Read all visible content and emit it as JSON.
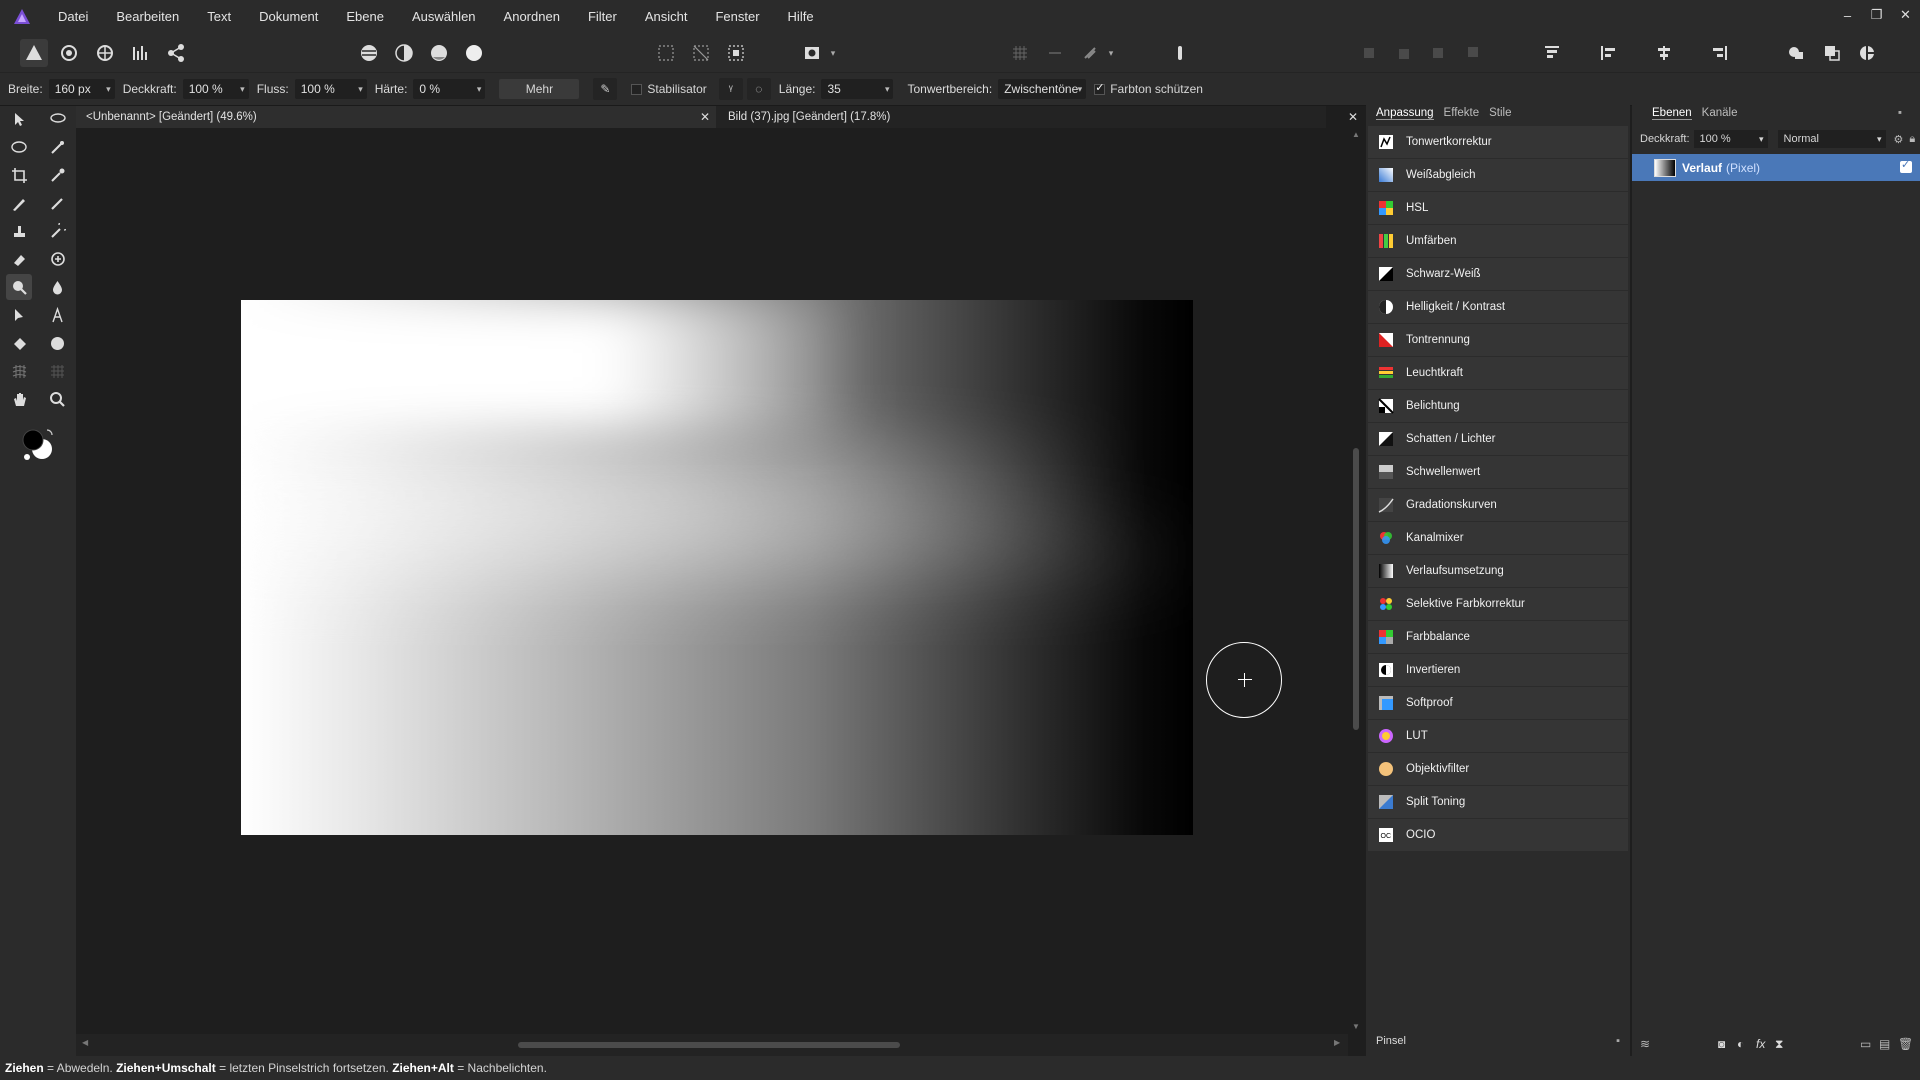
{
  "menubar": {
    "items": [
      "Datei",
      "Bearbeiten",
      "Text",
      "Dokument",
      "Ebene",
      "Auswählen",
      "Anordnen",
      "Filter",
      "Ansicht",
      "Fenster",
      "Hilfe"
    ],
    "window_buttons": {
      "minimize": "–",
      "restore": "❐",
      "close": "✕"
    }
  },
  "context": {
    "width_label": "Breite:",
    "width_value": "160 px",
    "opacity_label": "Deckkraft:",
    "opacity_value": "100 %",
    "flow_label": "Fluss:",
    "flow_value": "100 %",
    "hardness_label": "Härte:",
    "hardness_value": "0 %",
    "more_label": "Mehr",
    "stabilizer_label": "Stabilisator",
    "length_label": "Länge:",
    "length_value": "35",
    "tonal_label": "Tonwertbereich:",
    "tonal_value": "Zwischentöne",
    "protect_label": "Farbton schützen"
  },
  "doctabs": [
    {
      "title": "<Unbenannt> [Geändert] (49.6%)"
    },
    {
      "title": "Bild (37).jpg [Geändert] (17.8%)"
    }
  ],
  "adjust": {
    "tabs": [
      "Anpassung",
      "Effekte",
      "Stile"
    ],
    "items": [
      {
        "label": "Tonwertkorrektur",
        "icon": "levels-icon"
      },
      {
        "label": "Weißabgleich",
        "icon": "white-balance-icon"
      },
      {
        "label": "HSL",
        "icon": "hsl-icon"
      },
      {
        "label": "Umfärben",
        "icon": "recolor-icon"
      },
      {
        "label": "Schwarz-Weiß",
        "icon": "black-white-icon"
      },
      {
        "label": "Helligkeit / Kontrast",
        "icon": "brightness-contrast-icon"
      },
      {
        "label": "Tontrennung",
        "icon": "posterize-icon"
      },
      {
        "label": "Leuchtkraft",
        "icon": "vibrance-icon"
      },
      {
        "label": "Belichtung",
        "icon": "exposure-icon"
      },
      {
        "label": "Schatten / Lichter",
        "icon": "shadows-highlights-icon"
      },
      {
        "label": "Schwellenwert",
        "icon": "threshold-icon"
      },
      {
        "label": "Gradationskurven",
        "icon": "curves-icon"
      },
      {
        "label": "Kanalmixer",
        "icon": "channel-mixer-icon"
      },
      {
        "label": "Verlaufsumsetzung",
        "icon": "gradient-map-icon"
      },
      {
        "label": "Selektive Farbkorrektur",
        "icon": "selective-color-icon"
      },
      {
        "label": "Farbbalance",
        "icon": "color-balance-icon"
      },
      {
        "label": "Invertieren",
        "icon": "invert-icon"
      },
      {
        "label": "Softproof",
        "icon": "soft-proof-icon"
      },
      {
        "label": "LUT",
        "icon": "lut-icon"
      },
      {
        "label": "Objektivfilter",
        "icon": "lens-filter-icon"
      },
      {
        "label": "Split Toning",
        "icon": "split-toning-icon"
      },
      {
        "label": "OCIO",
        "icon": "ocio-icon"
      }
    ],
    "footer_label": "Pinsel"
  },
  "layers": {
    "tabs": [
      "Ebenen",
      "Kanäle"
    ],
    "opacity_label": "Deckkraft:",
    "opacity_value": "100 %",
    "blend_mode": "Normal",
    "rows": [
      {
        "name": "Verlauf",
        "kind": "(Pixel)"
      }
    ]
  },
  "status": {
    "k1": "Ziehen",
    "t1": " = Abwedeln. ",
    "k2": "Ziehen+Umschalt",
    "t2": " = letzten Pinselstrich fortsetzen. ",
    "k3": "Ziehen+Alt",
    "t3": " = Nachbelichten."
  },
  "colors": {
    "accent": "#4a78b8",
    "logo": "#7b4fd6",
    "panel": "#2b2b2b",
    "canvas_bg": "#1e1e1e"
  }
}
